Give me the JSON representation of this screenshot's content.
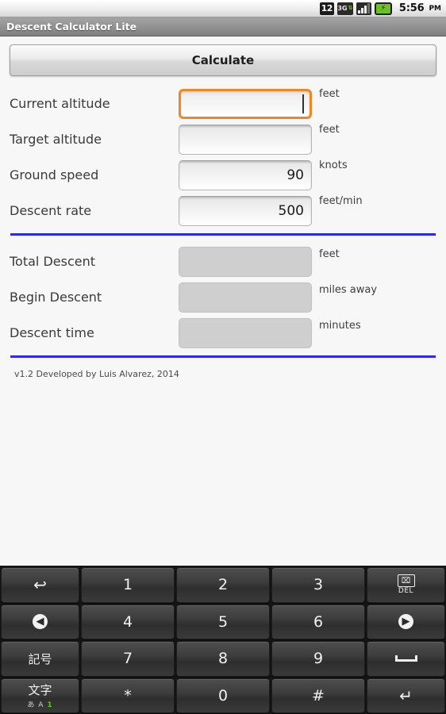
{
  "statusbar": {
    "notification_count": "12",
    "network_label": "3G",
    "network_arrows": "⇅",
    "battery_glyph": "⚡",
    "time": "5:56",
    "ampm": "PM"
  },
  "titlebar": {
    "title": "Descent Calculator Lite"
  },
  "main": {
    "calculate_label": "Calculate",
    "inputs": [
      {
        "label": "Current altitude",
        "value": "",
        "unit": "feet",
        "focused": true
      },
      {
        "label": "Target altitude",
        "value": "",
        "unit": "feet",
        "focused": false
      },
      {
        "label": "Ground speed",
        "value": "90",
        "unit": "knots",
        "focused": false
      },
      {
        "label": "Descent rate",
        "value": "500",
        "unit": "feet/min",
        "focused": false
      }
    ],
    "outputs": [
      {
        "label": "Total Descent",
        "value": "",
        "unit": "feet"
      },
      {
        "label": "Begin Descent",
        "value": "",
        "unit": "miles away"
      },
      {
        "label": "Descent time",
        "value": "",
        "unit": "minutes"
      }
    ],
    "footer": "v1.2 Developed by Luis Alvarez, 2014",
    "divider_color": "#2b2bf0",
    "focus_color": "#ef8822"
  },
  "keyboard": {
    "rows": [
      [
        {
          "name": "undo-key",
          "glyph": "↩",
          "type": "glyph"
        },
        {
          "name": "key-1",
          "glyph": "1",
          "type": "digit"
        },
        {
          "name": "key-2",
          "glyph": "2",
          "type": "digit"
        },
        {
          "name": "key-3",
          "glyph": "3",
          "type": "digit"
        },
        {
          "name": "delete-key",
          "glyph": "⌧",
          "sub": "DEL",
          "type": "del"
        }
      ],
      [
        {
          "name": "cursor-left-key",
          "glyph": "◀",
          "type": "circle"
        },
        {
          "name": "key-4",
          "glyph": "4",
          "type": "digit"
        },
        {
          "name": "key-5",
          "glyph": "5",
          "type": "digit"
        },
        {
          "name": "key-6",
          "glyph": "6",
          "type": "digit"
        },
        {
          "name": "cursor-right-key",
          "glyph": "▶",
          "type": "circle"
        }
      ],
      [
        {
          "name": "symbols-key",
          "glyph": "記号",
          "type": "jp"
        },
        {
          "name": "key-7",
          "glyph": "7",
          "type": "digit"
        },
        {
          "name": "key-8",
          "glyph": "8",
          "type": "digit"
        },
        {
          "name": "key-9",
          "glyph": "9",
          "type": "digit"
        },
        {
          "name": "space-key",
          "glyph": "␣",
          "type": "space"
        }
      ],
      [
        {
          "name": "input-mode-key",
          "glyph": "文字",
          "sub_kana": "あ",
          "sub_alpha": "A",
          "sub_num": "1",
          "type": "mode"
        },
        {
          "name": "key-asterisk",
          "glyph": "*",
          "type": "digit"
        },
        {
          "name": "key-0",
          "glyph": "0",
          "type": "digit"
        },
        {
          "name": "key-hash",
          "glyph": "#",
          "type": "digit"
        },
        {
          "name": "enter-key",
          "glyph": "↵",
          "type": "glyph"
        }
      ]
    ]
  }
}
